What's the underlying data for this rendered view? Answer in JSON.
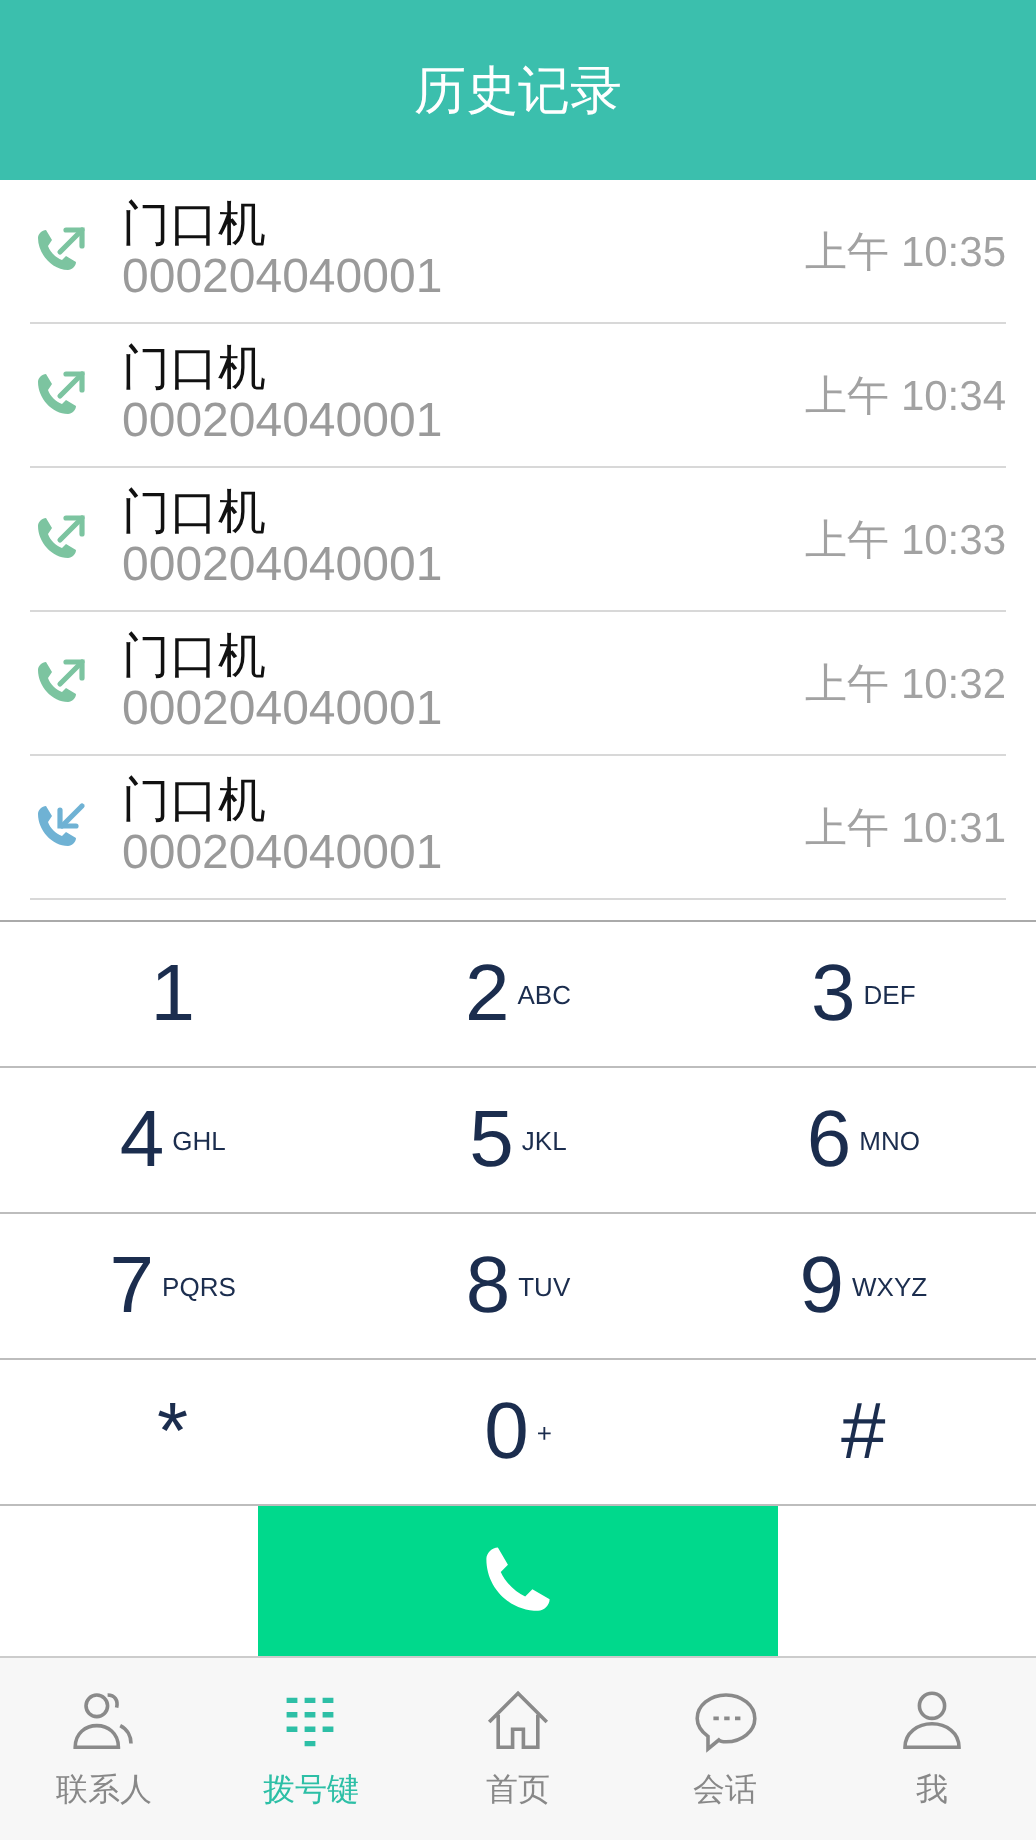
{
  "header": {
    "title": "历史记录"
  },
  "calls": [
    {
      "name": "门口机",
      "number": "000204040001",
      "time": "上午 10:35",
      "kind": "outgoing"
    },
    {
      "name": "门口机",
      "number": "000204040001",
      "time": "上午 10:34",
      "kind": "outgoing"
    },
    {
      "name": "门口机",
      "number": "000204040001",
      "time": "上午 10:33",
      "kind": "outgoing"
    },
    {
      "name": "门口机",
      "number": "000204040001",
      "time": "上午 10:32",
      "kind": "outgoing"
    },
    {
      "name": "门口机",
      "number": "000204040001",
      "time": "上午 10:31",
      "kind": "incoming"
    }
  ],
  "keypad": [
    {
      "digit": "1"
    },
    {
      "digit": "2",
      "letters": "ABC"
    },
    {
      "digit": "3",
      "letters": "DEF"
    },
    {
      "digit": "4",
      "letters": "GHL"
    },
    {
      "digit": "5",
      "letters": "JKL"
    },
    {
      "digit": "6",
      "letters": "MNO"
    },
    {
      "digit": "7",
      "letters": "PQRS"
    },
    {
      "digit": "8",
      "letters": "TUV"
    },
    {
      "digit": "9",
      "letters": "WXYZ"
    },
    {
      "digit": "*"
    },
    {
      "digit": "0",
      "letters": "+"
    },
    {
      "digit": "#"
    }
  ],
  "tabs": [
    {
      "label": "联系人",
      "kind": "contacts",
      "selected": false
    },
    {
      "label": "拨号键",
      "kind": "dialpad",
      "selected": true
    },
    {
      "label": "首页",
      "kind": "home",
      "selected": false
    },
    {
      "label": "会话",
      "kind": "chat",
      "selected": false
    },
    {
      "label": "我",
      "kind": "me",
      "selected": false
    }
  ]
}
